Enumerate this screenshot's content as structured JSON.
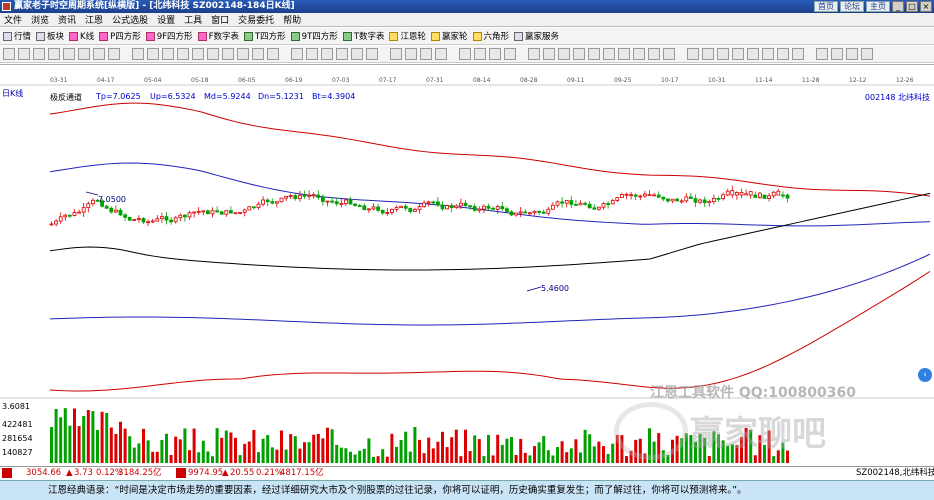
{
  "window": {
    "title": "赢家老子时空周期系统[纵横版] - [北纬科技  SZ002148-184日K线]",
    "links": [
      "首页",
      "论坛",
      "主页"
    ],
    "controls": [
      "_",
      "□",
      "×"
    ]
  },
  "menu": [
    "文件",
    "浏览",
    "资讯",
    "江恩",
    "公式选股",
    "设置",
    "工具",
    "窗口",
    "交易委托",
    "帮助"
  ],
  "toolbar1": [
    "行情",
    "板块",
    "K线",
    "P四方形",
    "9F四方形",
    "F数字表",
    "T四方形",
    "9T四方形",
    "T数字表",
    "江恩轮",
    "赢家轮",
    "六角形",
    "赢家服务"
  ],
  "chart": {
    "period_label": "日K线",
    "indicator": "极反通道",
    "params": {
      "Tp": "Tp=7.0625",
      "Up": "Up=6.5324",
      "Md": "Md=5.9244",
      "Dn": "Dn=5.1231",
      "Bt": "Bt=4.3904"
    },
    "stock": "002148 北纬科技",
    "dates": [
      "03-31",
      "04-17",
      "05-04",
      "05-18",
      "06-05",
      "06-19",
      "07-03",
      "07-17",
      "07-31",
      "08-14",
      "08-28",
      "09-11",
      "09-25",
      "10-17",
      "10-31",
      "11-14",
      "11-28",
      "12-12",
      "12-26"
    ],
    "high_marker": "7.0500",
    "low_marker": "5.4600",
    "colors": {
      "upper_red": "#cc0000",
      "upper_blue": "#2222bb",
      "mid": "#000000",
      "up_candle": "#dd0000",
      "down_candle": "#00a000"
    }
  },
  "volume": {
    "labels": [
      "3.6081",
      "422481",
      "281654",
      "140827"
    ]
  },
  "status": {
    "sh_index": "3054.66",
    "sh_change": "3.73",
    "sh_pct": "0.12%",
    "sh_vol": "3184.25亿",
    "sz_index": "9974.95",
    "sz_change": "20.55",
    "sz_pct": "0.21%",
    "sz_vol": "4817.15亿",
    "stock": "SZ002148,北纬科技"
  },
  "watermark": {
    "line1": "江恩工具软件  QQ:100800360",
    "line2": "赢家聊吧"
  },
  "bottom_quote": "江恩经典语录：“时间是决定市场走势的重要因素，经过详细研究大市及个别股票的过往记录，你将可以证明，历史确实重复发生；而了解过往，你将可以预测将来。”。"
}
